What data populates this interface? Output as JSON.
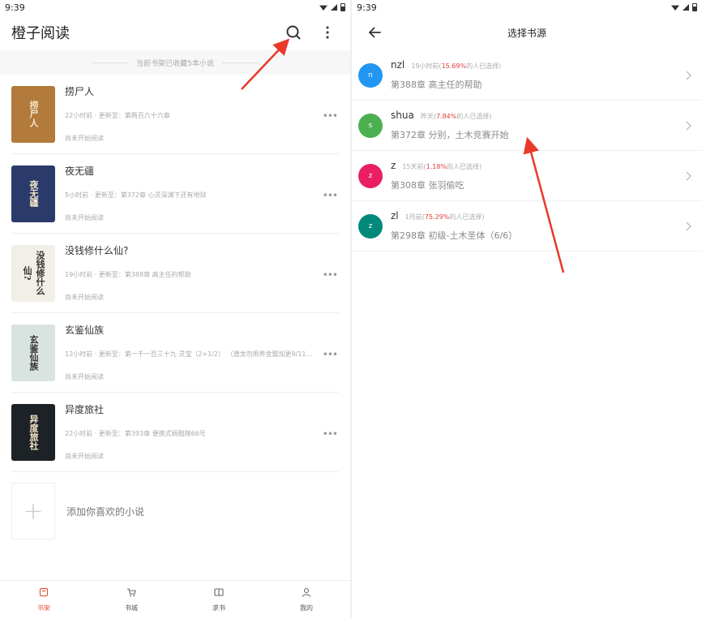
{
  "left": {
    "status": {
      "time": "9:39"
    },
    "appbar": {
      "title": "橙子阅读"
    },
    "notice": "当前书架已收藏5本小说",
    "books": [
      {
        "title": "捞尸人",
        "update": "22小时前 · 更新至：第两百六十六章",
        "status": "尚未开始阅读",
        "cover_text": "捞尸人",
        "cover_color": "#b27a3b"
      },
      {
        "title": "夜无疆",
        "update": "5小时前 · 更新至：第372章 心灵深渊下还有地狱",
        "status": "尚未开始阅读",
        "cover_text": "夜无疆",
        "cover_color": "#2a3b6b"
      },
      {
        "title": "没钱修什么仙?",
        "update": "19小时前 · 更新至：第388章 高主任的帮助",
        "status": "尚未开始阅读",
        "cover_text": "没钱修什么仙?",
        "cover_color": "#f2efe8"
      },
      {
        "title": "玄鉴仙族",
        "update": "12小时前 · 更新至：第一千一百三十九 灵宝（2+1/2） （潜龙勿用养金盟加更9/11...",
        "status": "尚未开始阅读",
        "cover_text": "玄鉴仙族",
        "cover_color": "#d9e4e0"
      },
      {
        "title": "异度旅社",
        "update": "22小时前 · 更新至：第393章 便携式杨戬随66号",
        "status": "尚未开始阅读",
        "cover_text": "异度旅社",
        "cover_color": "#1d2226"
      }
    ],
    "add_label": "添加你喜欢的小说",
    "tabs": [
      {
        "label": "书架",
        "icon": "bookshelf-icon",
        "active": true
      },
      {
        "label": "书城",
        "icon": "cart-icon",
        "active": false
      },
      {
        "label": "求书",
        "icon": "book-open-icon",
        "active": false
      },
      {
        "label": "我的",
        "icon": "user-icon",
        "active": false
      }
    ]
  },
  "right": {
    "status": {
      "time": "9:39"
    },
    "appbar": {
      "title": "选择书源"
    },
    "sources": [
      {
        "avatar": "n",
        "name": "nzl",
        "time": "19小时前(",
        "pct": "15.69%",
        "suffix": "的人已选择)",
        "chapter": "第388章 高主任的帮助",
        "color": "#2196f3"
      },
      {
        "avatar": "s",
        "name": "shua",
        "time": "昨天(",
        "pct": "7.84%",
        "suffix": "的人已选择)",
        "chapter": "第372章 分别，土木竞赛开始",
        "color": "#4caf50"
      },
      {
        "avatar": "z",
        "name": "z",
        "time": "15天前(",
        "pct": "1.18%",
        "suffix": "的人已选择)",
        "chapter": "第308章 张羽偷吃",
        "color": "#e91e63"
      },
      {
        "avatar": "z",
        "name": "zl",
        "time": "1月前(",
        "pct": "75.29%",
        "suffix": "的人已选择)",
        "chapter": "第298章 初级-土木圣体（6/6）",
        "color": "#00897b"
      }
    ]
  },
  "colors": {
    "accent": "#e55a3a",
    "annotation": "#e8392b"
  }
}
